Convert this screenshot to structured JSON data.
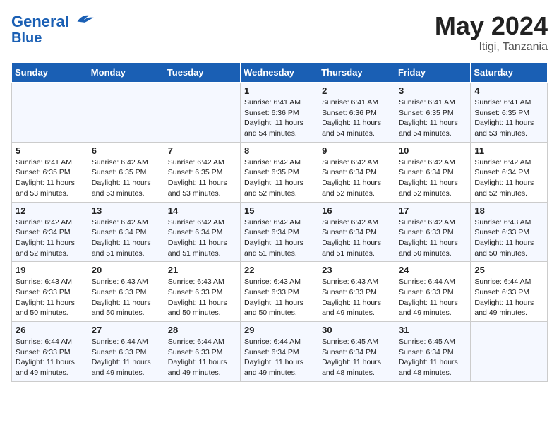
{
  "header": {
    "logo_line1": "General",
    "logo_line2": "Blue",
    "month_year": "May 2024",
    "location": "Itigi, Tanzania"
  },
  "weekdays": [
    "Sunday",
    "Monday",
    "Tuesday",
    "Wednesday",
    "Thursday",
    "Friday",
    "Saturday"
  ],
  "weeks": [
    [
      {
        "day": "",
        "sunrise": "",
        "sunset": "",
        "daylight": ""
      },
      {
        "day": "",
        "sunrise": "",
        "sunset": "",
        "daylight": ""
      },
      {
        "day": "",
        "sunrise": "",
        "sunset": "",
        "daylight": ""
      },
      {
        "day": "1",
        "sunrise": "Sunrise: 6:41 AM",
        "sunset": "Sunset: 6:36 PM",
        "daylight": "Daylight: 11 hours and 54 minutes."
      },
      {
        "day": "2",
        "sunrise": "Sunrise: 6:41 AM",
        "sunset": "Sunset: 6:36 PM",
        "daylight": "Daylight: 11 hours and 54 minutes."
      },
      {
        "day": "3",
        "sunrise": "Sunrise: 6:41 AM",
        "sunset": "Sunset: 6:35 PM",
        "daylight": "Daylight: 11 hours and 54 minutes."
      },
      {
        "day": "4",
        "sunrise": "Sunrise: 6:41 AM",
        "sunset": "Sunset: 6:35 PM",
        "daylight": "Daylight: 11 hours and 53 minutes."
      }
    ],
    [
      {
        "day": "5",
        "sunrise": "Sunrise: 6:41 AM",
        "sunset": "Sunset: 6:35 PM",
        "daylight": "Daylight: 11 hours and 53 minutes."
      },
      {
        "day": "6",
        "sunrise": "Sunrise: 6:42 AM",
        "sunset": "Sunset: 6:35 PM",
        "daylight": "Daylight: 11 hours and 53 minutes."
      },
      {
        "day": "7",
        "sunrise": "Sunrise: 6:42 AM",
        "sunset": "Sunset: 6:35 PM",
        "daylight": "Daylight: 11 hours and 53 minutes."
      },
      {
        "day": "8",
        "sunrise": "Sunrise: 6:42 AM",
        "sunset": "Sunset: 6:35 PM",
        "daylight": "Daylight: 11 hours and 52 minutes."
      },
      {
        "day": "9",
        "sunrise": "Sunrise: 6:42 AM",
        "sunset": "Sunset: 6:34 PM",
        "daylight": "Daylight: 11 hours and 52 minutes."
      },
      {
        "day": "10",
        "sunrise": "Sunrise: 6:42 AM",
        "sunset": "Sunset: 6:34 PM",
        "daylight": "Daylight: 11 hours and 52 minutes."
      },
      {
        "day": "11",
        "sunrise": "Sunrise: 6:42 AM",
        "sunset": "Sunset: 6:34 PM",
        "daylight": "Daylight: 11 hours and 52 minutes."
      }
    ],
    [
      {
        "day": "12",
        "sunrise": "Sunrise: 6:42 AM",
        "sunset": "Sunset: 6:34 PM",
        "daylight": "Daylight: 11 hours and 52 minutes."
      },
      {
        "day": "13",
        "sunrise": "Sunrise: 6:42 AM",
        "sunset": "Sunset: 6:34 PM",
        "daylight": "Daylight: 11 hours and 51 minutes."
      },
      {
        "day": "14",
        "sunrise": "Sunrise: 6:42 AM",
        "sunset": "Sunset: 6:34 PM",
        "daylight": "Daylight: 11 hours and 51 minutes."
      },
      {
        "day": "15",
        "sunrise": "Sunrise: 6:42 AM",
        "sunset": "Sunset: 6:34 PM",
        "daylight": "Daylight: 11 hours and 51 minutes."
      },
      {
        "day": "16",
        "sunrise": "Sunrise: 6:42 AM",
        "sunset": "Sunset: 6:34 PM",
        "daylight": "Daylight: 11 hours and 51 minutes."
      },
      {
        "day": "17",
        "sunrise": "Sunrise: 6:42 AM",
        "sunset": "Sunset: 6:33 PM",
        "daylight": "Daylight: 11 hours and 50 minutes."
      },
      {
        "day": "18",
        "sunrise": "Sunrise: 6:43 AM",
        "sunset": "Sunset: 6:33 PM",
        "daylight": "Daylight: 11 hours and 50 minutes."
      }
    ],
    [
      {
        "day": "19",
        "sunrise": "Sunrise: 6:43 AM",
        "sunset": "Sunset: 6:33 PM",
        "daylight": "Daylight: 11 hours and 50 minutes."
      },
      {
        "day": "20",
        "sunrise": "Sunrise: 6:43 AM",
        "sunset": "Sunset: 6:33 PM",
        "daylight": "Daylight: 11 hours and 50 minutes."
      },
      {
        "day": "21",
        "sunrise": "Sunrise: 6:43 AM",
        "sunset": "Sunset: 6:33 PM",
        "daylight": "Daylight: 11 hours and 50 minutes."
      },
      {
        "day": "22",
        "sunrise": "Sunrise: 6:43 AM",
        "sunset": "Sunset: 6:33 PM",
        "daylight": "Daylight: 11 hours and 50 minutes."
      },
      {
        "day": "23",
        "sunrise": "Sunrise: 6:43 AM",
        "sunset": "Sunset: 6:33 PM",
        "daylight": "Daylight: 11 hours and 49 minutes."
      },
      {
        "day": "24",
        "sunrise": "Sunrise: 6:44 AM",
        "sunset": "Sunset: 6:33 PM",
        "daylight": "Daylight: 11 hours and 49 minutes."
      },
      {
        "day": "25",
        "sunrise": "Sunrise: 6:44 AM",
        "sunset": "Sunset: 6:33 PM",
        "daylight": "Daylight: 11 hours and 49 minutes."
      }
    ],
    [
      {
        "day": "26",
        "sunrise": "Sunrise: 6:44 AM",
        "sunset": "Sunset: 6:33 PM",
        "daylight": "Daylight: 11 hours and 49 minutes."
      },
      {
        "day": "27",
        "sunrise": "Sunrise: 6:44 AM",
        "sunset": "Sunset: 6:33 PM",
        "daylight": "Daylight: 11 hours and 49 minutes."
      },
      {
        "day": "28",
        "sunrise": "Sunrise: 6:44 AM",
        "sunset": "Sunset: 6:33 PM",
        "daylight": "Daylight: 11 hours and 49 minutes."
      },
      {
        "day": "29",
        "sunrise": "Sunrise: 6:44 AM",
        "sunset": "Sunset: 6:34 PM",
        "daylight": "Daylight: 11 hours and 49 minutes."
      },
      {
        "day": "30",
        "sunrise": "Sunrise: 6:45 AM",
        "sunset": "Sunset: 6:34 PM",
        "daylight": "Daylight: 11 hours and 48 minutes."
      },
      {
        "day": "31",
        "sunrise": "Sunrise: 6:45 AM",
        "sunset": "Sunset: 6:34 PM",
        "daylight": "Daylight: 11 hours and 48 minutes."
      },
      {
        "day": "",
        "sunrise": "",
        "sunset": "",
        "daylight": ""
      }
    ]
  ]
}
